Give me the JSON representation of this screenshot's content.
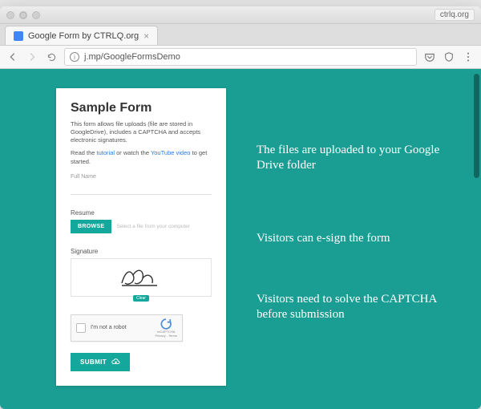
{
  "window": {
    "site_pill": "ctrlq.org"
  },
  "tab": {
    "title": "Google Form by CTRLQ.org",
    "close": "×"
  },
  "toolbar": {
    "url_prefix_icon": "i",
    "url": "j.mp/GoogleFormsDemo"
  },
  "form": {
    "title": "Sample Form",
    "desc_pre": "This form allows file uploads (file are stored in GoogleDrive), includes a CAPTCHA and accepts electronic signatures.",
    "desc_read": "Read the ",
    "tutorial_link": "tutorial",
    "desc_or": " or watch the ",
    "video_link": "YouTube video",
    "desc_tail": " to get started.",
    "fullname_label": "Full Name",
    "resume_label": "Resume",
    "browse_btn": "BROWSE",
    "file_placeholder": "Select a file from your computer",
    "signature_label": "Signature",
    "sig_clear": "Clear",
    "captcha_label": "I'm not a robot",
    "captcha_brand": "reCAPTCHA",
    "captcha_terms": "Privacy - Terms",
    "submit": "SUBMIT"
  },
  "annotations": {
    "a1": "The files are uploaded to your Google Drive folder",
    "a2": "Visitors can e-sign the form",
    "a3": "Visitors need to solve the CAPTCHA before submission"
  }
}
